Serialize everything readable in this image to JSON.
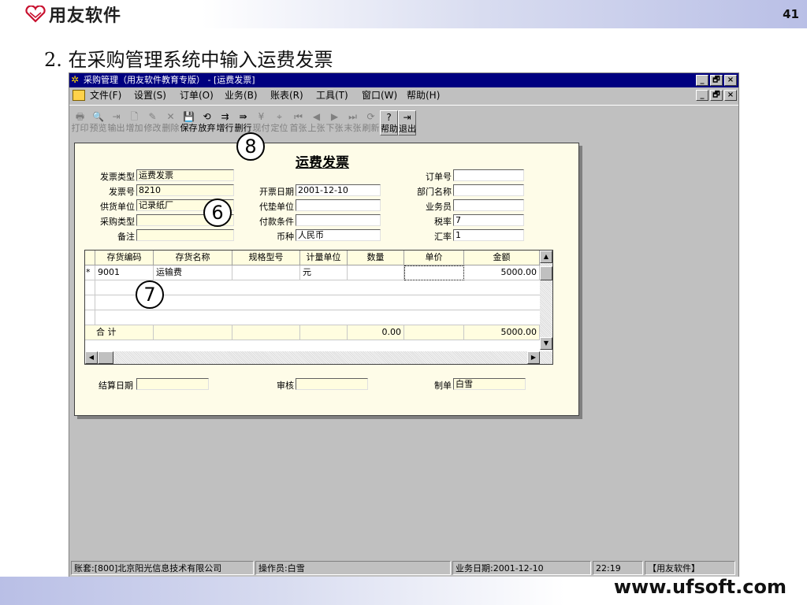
{
  "slide": {
    "brand": "用友软件",
    "page_number": "41",
    "heading": "2. 在采购管理系统中输入运费发票",
    "footer_url": "www.ufsoft.com"
  },
  "window": {
    "title": "采购管理（用友软件教育专版） - [运费发票]",
    "controls": [
      "_",
      "🗗",
      "×"
    ]
  },
  "menu": [
    "文件(F)",
    "设置(S)",
    "订单(O)",
    "业务(B)",
    "账表(R)",
    "工具(T)",
    "窗口(W)",
    "帮助(H)"
  ],
  "toolbar": [
    {
      "label": "打印",
      "icon": "print-icon",
      "glyph": "🖶",
      "enabled": false
    },
    {
      "label": "预览",
      "icon": "preview-icon",
      "glyph": "🔍",
      "enabled": false
    },
    {
      "label": "输出",
      "icon": "export-icon",
      "glyph": "⇥",
      "enabled": false
    },
    {
      "label": "增加",
      "icon": "add-icon",
      "glyph": "🗋",
      "enabled": false
    },
    {
      "label": "修改",
      "icon": "edit-icon",
      "glyph": "✎",
      "enabled": false
    },
    {
      "label": "删除",
      "icon": "delete-icon",
      "glyph": "✕",
      "enabled": false
    },
    {
      "label": "保存",
      "icon": "save-icon",
      "glyph": "💾",
      "enabled": true
    },
    {
      "label": "放弃",
      "icon": "discard-icon",
      "glyph": "⟲",
      "enabled": true
    },
    {
      "label": "增行",
      "icon": "add-row-icon",
      "glyph": "⇉",
      "enabled": true
    },
    {
      "label": "删行",
      "icon": "delete-row-icon",
      "glyph": "⇛",
      "enabled": true
    },
    {
      "label": "现付",
      "icon": "pay-icon",
      "glyph": "¥",
      "enabled": false
    },
    {
      "label": "定位",
      "icon": "locate-icon",
      "glyph": "⌖",
      "enabled": false
    },
    {
      "label": "首张",
      "icon": "first-icon",
      "glyph": "⏮",
      "enabled": false
    },
    {
      "label": "上张",
      "icon": "prev-icon",
      "glyph": "◀",
      "enabled": false
    },
    {
      "label": "下张",
      "icon": "next-icon",
      "glyph": "▶",
      "enabled": false
    },
    {
      "label": "末张",
      "icon": "last-icon",
      "glyph": "⏭",
      "enabled": false
    },
    {
      "label": "刷新",
      "icon": "refresh-icon",
      "glyph": "⟳",
      "enabled": false
    },
    {
      "label": "帮助",
      "icon": "help-icon",
      "glyph": "?",
      "enabled": true
    },
    {
      "label": "退出",
      "icon": "exit-icon",
      "glyph": "⇥",
      "enabled": true
    }
  ],
  "form": {
    "title": "运费发票",
    "invoice_type": {
      "label": "发票类型",
      "value": "运费发票"
    },
    "invoice_no": {
      "label": "发票号",
      "value": "8210"
    },
    "supplier": {
      "label": "供货单位",
      "value": "记录纸厂"
    },
    "purchase_type": {
      "label": "采购类型",
      "value": ""
    },
    "remark": {
      "label": "备注",
      "value": ""
    },
    "issue_date": {
      "label": "开票日期",
      "value": "2001-12-10"
    },
    "advance_unit": {
      "label": "代垫单位",
      "value": ""
    },
    "payment_terms": {
      "label": "付款条件",
      "value": ""
    },
    "currency": {
      "label": "币种",
      "value": "人民币"
    },
    "order_no": {
      "label": "订单号",
      "value": ""
    },
    "department": {
      "label": "部门名称",
      "value": ""
    },
    "salesperson": {
      "label": "业务员",
      "value": ""
    },
    "tax_rate": {
      "label": "税率",
      "value": "7"
    },
    "exchange_rate": {
      "label": "汇率",
      "value": "1"
    },
    "settle_date": {
      "label": "结算日期",
      "value": ""
    },
    "auditor": {
      "label": "审核",
      "value": ""
    },
    "maker": {
      "label": "制单",
      "value": "白雪"
    }
  },
  "table": {
    "columns": [
      "存货编码",
      "存货名称",
      "规格型号",
      "计量单位",
      "数量",
      "单价",
      "金额"
    ],
    "rows": [
      {
        "marker": "*",
        "code": "9001",
        "name": "运输费",
        "spec": "",
        "unit": "元",
        "qty": "",
        "price": "",
        "amount": "5000.00"
      }
    ],
    "total": {
      "label": "合 计",
      "qty": "0.00",
      "amount": "5000.00"
    }
  },
  "callouts": {
    "save": "8",
    "header": "6",
    "line": "7"
  },
  "status_bar": {
    "account": "账套:[800]北京阳光信息技术有限公司",
    "operator": "操作员:白雪",
    "business_date": "业务日期:2001-12-10",
    "time": "22:19",
    "brand": "【用友软件】"
  }
}
